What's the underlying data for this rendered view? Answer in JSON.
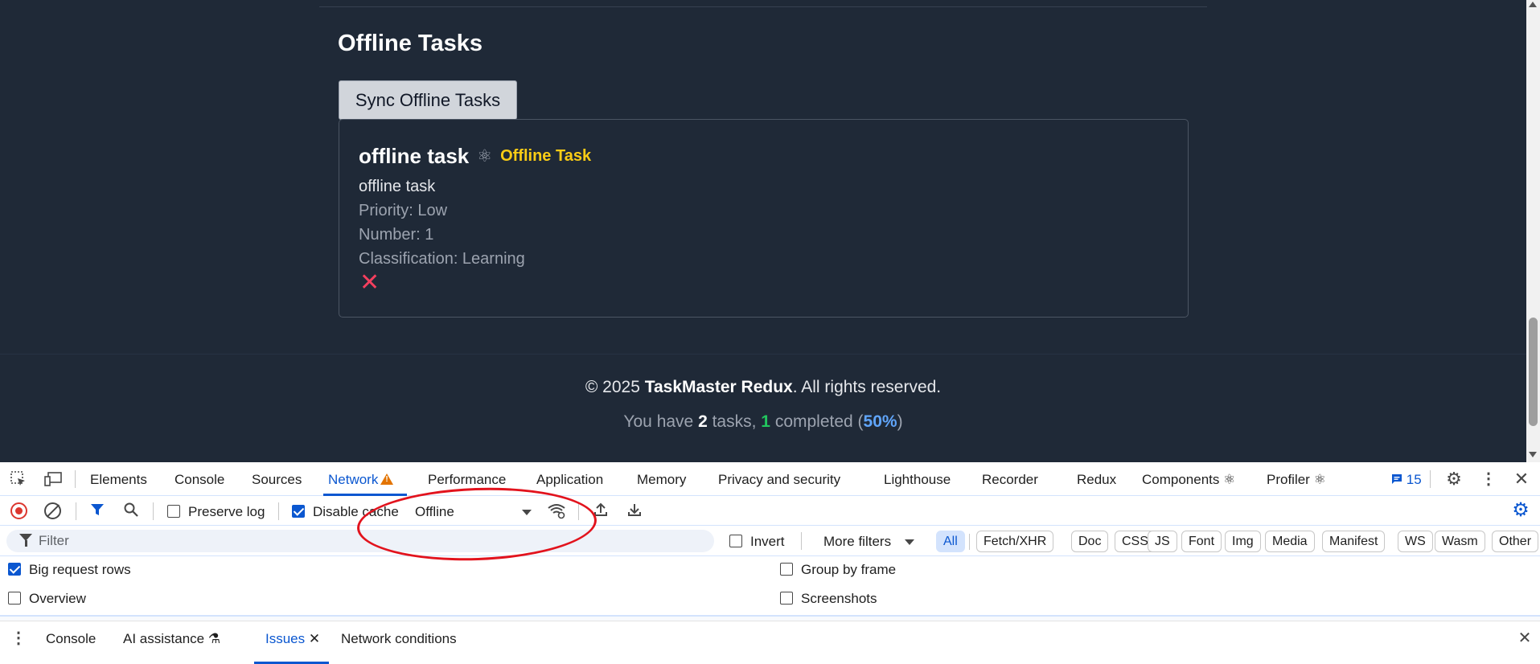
{
  "app": {
    "section_title": "Offline Tasks",
    "sync_button": "Sync Offline Tasks",
    "task": {
      "title": "offline task",
      "badge": "Offline Task",
      "description": "offline task",
      "priority": "Priority: Low",
      "number": "Number: 1",
      "classification": "Classification: Learning",
      "delete_glyph": "✕"
    },
    "footer": {
      "copyright_prefix": "© 2025 ",
      "brand": "TaskMaster Redux",
      "copyright_suffix": ". All rights reserved.",
      "stats_prefix": "You have ",
      "total": "2",
      "stats_mid": " tasks, ",
      "completed": "1",
      "stats_mid2": " completed (",
      "percent": "50%",
      "stats_suffix": ")"
    }
  },
  "devtools": {
    "tabs": [
      {
        "label": "Elements"
      },
      {
        "label": "Console"
      },
      {
        "label": "Sources"
      },
      {
        "label": "Network"
      },
      {
        "label": "Performance"
      },
      {
        "label": "Application"
      },
      {
        "label": "Memory"
      },
      {
        "label": "Privacy and security"
      },
      {
        "label": "Lighthouse"
      },
      {
        "label": "Recorder"
      },
      {
        "label": "Redux"
      },
      {
        "label": "Components ⚛"
      },
      {
        "label": "Profiler ⚛"
      }
    ],
    "active_tab": "Network",
    "issues_count": "15",
    "toolbar": {
      "preserve_log": "Preserve log",
      "disable_cache": "Disable cache",
      "throttle": "Offline"
    },
    "filter": {
      "placeholder": "Filter",
      "invert": "Invert",
      "more_filters": "More filters",
      "chips": [
        "All",
        "Fetch/XHR",
        "Doc",
        "CSS",
        "JS",
        "Font",
        "Img",
        "Media",
        "Manifest",
        "WS",
        "Wasm",
        "Other"
      ]
    },
    "options": {
      "big_request_rows": "Big request rows",
      "overview": "Overview",
      "group_by_frame": "Group by frame",
      "screenshots": "Screenshots"
    },
    "drawer": {
      "tabs": [
        "Console",
        "AI assistance",
        "Issues",
        "Network conditions"
      ],
      "active": "Issues"
    },
    "colors": {
      "accent": "#0b57d0",
      "record": "#dc362e",
      "annotation": "#e2131d"
    }
  }
}
